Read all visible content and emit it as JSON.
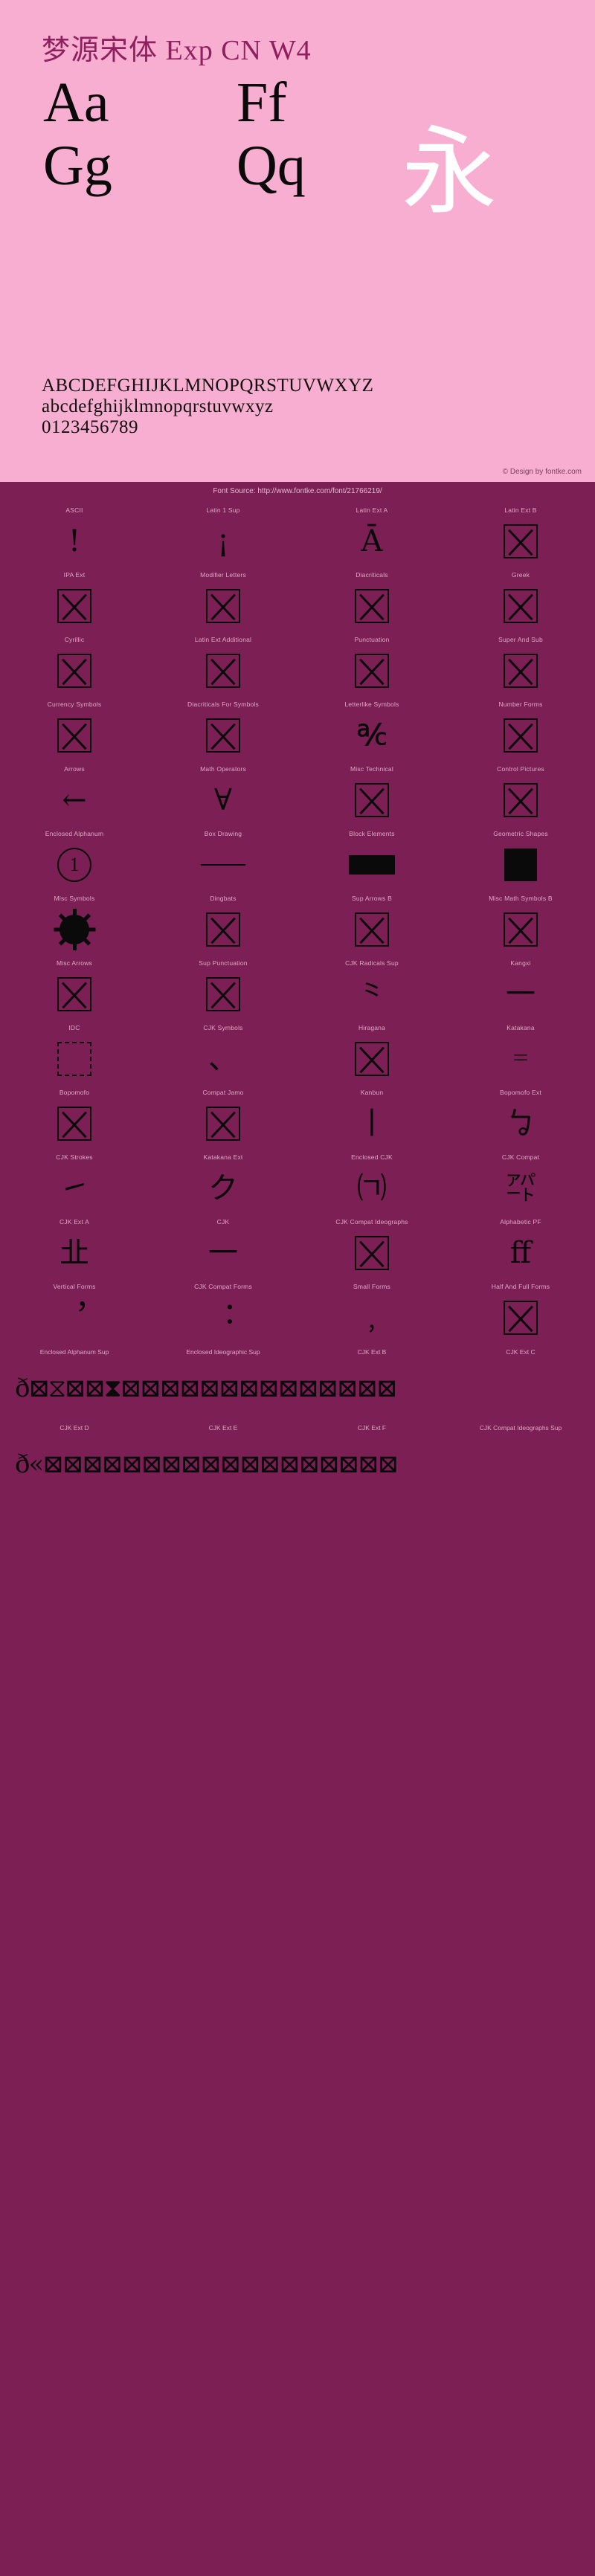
{
  "header": {
    "font_title": "梦源宋体 Exp CN W4",
    "glyph_pairs": [
      "Aa",
      "Ff",
      "Gg",
      "Qq"
    ],
    "cjk_showcase": "永",
    "alphabet_upper": "ABCDEFGHIJKLMNOPQRSTUVWXYZ",
    "alphabet_lower": "abcdefghijklmnopqrstuvwxyz",
    "digits": "0123456789",
    "design_credit": "© Design by fontke.com",
    "accent_color": "#8e2060",
    "header_bg": "#f7aed1",
    "body_bg": "#7c1f54"
  },
  "source_bar": {
    "text": "Font Source: http://www.fontke.com/font/21766219/"
  },
  "blocks": [
    {
      "label": "ASCII",
      "sample": "!",
      "kind": "text"
    },
    {
      "label": "Latin 1 Sup",
      "sample": "¡",
      "kind": "text"
    },
    {
      "label": "Latin Ext A",
      "sample": "Ā",
      "kind": "text"
    },
    {
      "label": "Latin Ext B",
      "sample": "",
      "kind": "tofu"
    },
    {
      "label": "IPA Ext",
      "sample": "",
      "kind": "tofu"
    },
    {
      "label": "Modifier Letters",
      "sample": "",
      "kind": "tofu"
    },
    {
      "label": "Diacriticals",
      "sample": "",
      "kind": "tofu"
    },
    {
      "label": "Greek",
      "sample": "",
      "kind": "tofu"
    },
    {
      "label": "Cyrillic",
      "sample": "",
      "kind": "tofu"
    },
    {
      "label": "Latin Ext Additional",
      "sample": "",
      "kind": "tofu"
    },
    {
      "label": "Punctuation",
      "sample": "",
      "kind": "tofu"
    },
    {
      "label": "Super And Sub",
      "sample": "",
      "kind": "tofu"
    },
    {
      "label": "Currency Symbols",
      "sample": "",
      "kind": "tofu"
    },
    {
      "label": "Diacriticals For Symbols",
      "sample": "",
      "kind": "tofu"
    },
    {
      "label": "Letterlike Symbols",
      "sample": "℀",
      "kind": "text"
    },
    {
      "label": "Number Forms",
      "sample": "",
      "kind": "tofu"
    },
    {
      "label": "Arrows",
      "sample": "←",
      "kind": "text"
    },
    {
      "label": "Math Operators",
      "sample": "∀",
      "kind": "text"
    },
    {
      "label": "Misc Technical",
      "sample": "",
      "kind": "tofu"
    },
    {
      "label": "Control Pictures",
      "sample": "",
      "kind": "tofu"
    },
    {
      "label": "Enclosed Alphanum",
      "sample": "①",
      "kind": "circled"
    },
    {
      "label": "Box Drawing",
      "sample": "─",
      "kind": "hline"
    },
    {
      "label": "Block Elements",
      "sample": "",
      "kind": "solid-rect"
    },
    {
      "label": "Geometric Shapes",
      "sample": "",
      "kind": "solid-sq"
    },
    {
      "label": "Misc Symbols",
      "sample": "☀",
      "kind": "sun"
    },
    {
      "label": "Dingbats",
      "sample": "",
      "kind": "tofu"
    },
    {
      "label": "Sup Arrows B",
      "sample": "",
      "kind": "tofu"
    },
    {
      "label": "Misc Math Symbols B",
      "sample": "",
      "kind": "tofu"
    },
    {
      "label": "Misc Arrows",
      "sample": "",
      "kind": "tofu"
    },
    {
      "label": "Sup Punctuation",
      "sample": "",
      "kind": "tofu"
    },
    {
      "label": "CJK Radicals Sup",
      "sample": "⺀",
      "kind": "text"
    },
    {
      "label": "Kangxi",
      "sample": "一",
      "kind": "text"
    },
    {
      "label": "IDC",
      "sample": "",
      "kind": "tofu-dashed"
    },
    {
      "label": "CJK Symbols",
      "sample": "、",
      "kind": "text"
    },
    {
      "label": "Hiragana",
      "sample": "",
      "kind": "tofu"
    },
    {
      "label": "Katakana",
      "sample": "゠",
      "kind": "text"
    },
    {
      "label": "Bopomofo",
      "sample": "",
      "kind": "tofu"
    },
    {
      "label": "Compat Jamo",
      "sample": "",
      "kind": "tofu"
    },
    {
      "label": "Kanbun",
      "sample": "丨",
      "kind": "text"
    },
    {
      "label": "Bopomofo Ext",
      "sample": "ㆠ",
      "kind": "text"
    },
    {
      "label": "CJK Strokes",
      "sample": "㇀",
      "kind": "text"
    },
    {
      "label": "Katakana Ext",
      "sample": "ク",
      "kind": "text"
    },
    {
      "label": "Enclosed CJK",
      "sample": "㈀",
      "kind": "text"
    },
    {
      "label": "CJK Compat",
      "sample": "㌀",
      "kind": "text"
    },
    {
      "label": "CJK Ext A",
      "sample": "㐀",
      "kind": "text"
    },
    {
      "label": "CJK",
      "sample": "一",
      "kind": "text"
    },
    {
      "label": "CJK Compat Ideographs",
      "sample": "",
      "kind": "tofu"
    },
    {
      "label": "Alphabetic PF",
      "sample": "ﬀ",
      "kind": "text"
    },
    {
      "label": "Vertical Forms",
      "sample": "︐",
      "kind": "text"
    },
    {
      "label": "CJK Compat Forms",
      "sample": "︓",
      "kind": "text"
    },
    {
      "label": "Small Forms",
      "sample": "﹐",
      "kind": "text"
    },
    {
      "label": "Half And Full Forms",
      "sample": "",
      "kind": "tofu"
    }
  ],
  "wide_rows": [
    {
      "labels": [
        "Enclosed Alphanum Sup",
        "Enclosed Ideographic Sup",
        "CJK Ext B",
        "CJK Ext C"
      ],
      "sample": "ð⊠⧖⊠⊠⧗⊠⊠⊠⊠⊠⊠⊠⊠⊠⊠⊠⊠⊠⊠"
    },
    {
      "labels": [
        "CJK Ext D",
        "CJK Ext E",
        "CJK Ext F",
        "CJK Compat Ideographs Sup"
      ],
      "sample": "ð«⊠⊠⊠⊠⊠⊠⊠⊠⊠⊠⊠⊠⊠⊠⊠⊠⊠⊠"
    }
  ]
}
